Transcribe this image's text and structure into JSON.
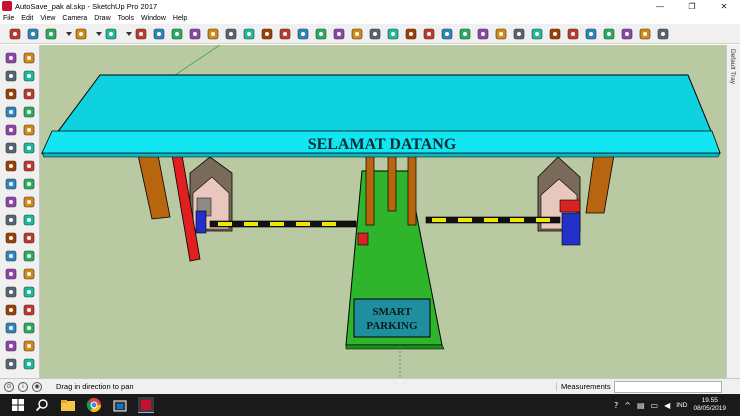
{
  "window": {
    "title": "AutoSave_pak al.skp - SketchUp Pro 2017",
    "minimize": "—",
    "maximize": "❐",
    "close": "✕"
  },
  "menu": [
    "File",
    "Edit",
    "View",
    "Camera",
    "Draw",
    "Tools",
    "Window",
    "Help"
  ],
  "toolbar_icons": [
    "select-icon",
    "eraser-icon",
    "pencil-icon",
    "dropdown-icon",
    "arc-icon",
    "dropdown-icon",
    "circle-icon",
    "dropdown-icon",
    "push-pull-icon",
    "follow-me-icon",
    "move-icon",
    "rotate-icon",
    "scale-icon",
    "tape-measure-icon",
    "text-icon",
    "paint-bucket-icon",
    "orbit-icon",
    "pan-icon",
    "zoom-icon",
    "zoom-extents-icon",
    "warehouse-icon",
    "extension-icon",
    "share-model-icon",
    "ruby-icon",
    "section-icon",
    "section-plane-icon",
    "xray-icon",
    "wireframe-icon",
    "hidden-line-icon",
    "shaded-icon",
    "textured-icon",
    "monochrome-icon",
    "iso-view-icon",
    "top-view-icon",
    "front-view-icon",
    "right-view-icon",
    "back-view-icon",
    "left-view-icon"
  ],
  "palette_icons": [
    "select-icon",
    "component-icon",
    "paint-bucket-icon",
    "eraser-icon",
    "line-icon",
    "freehand-icon",
    "rectangle-icon",
    "rotated-rectangle-icon",
    "circle-icon",
    "polygon-icon",
    "arc-icon",
    "pie-icon",
    "two-point-arc-icon",
    "three-point-arc-icon",
    "move-icon",
    "push-pull-icon",
    "rotate-icon",
    "follow-me-icon",
    "scale-icon",
    "offset-icon",
    "tape-measure-icon",
    "dimension-icon",
    "protractor-icon",
    "text-icon",
    "axes-icon",
    "3d-text-icon",
    "orbit-icon",
    "pan-icon",
    "zoom-icon",
    "zoom-window-icon",
    "zoom-extents-icon",
    "previous-view-icon",
    "position-camera-icon",
    "look-around-icon",
    "walk-icon",
    "section-plane-icon"
  ],
  "scene": {
    "sign_text": "SELAMAT DATANG",
    "panel_line1": "SMART",
    "panel_line2": "PARKING"
  },
  "colors": {
    "canvas": "#b9c9a1",
    "canopy_top": "#0fd2e0",
    "canopy_front": "#12e6f2",
    "pillar": "#b8650f",
    "island": "#2fb52c",
    "panel": "#1f8fa0",
    "barrier_yellow": "#f2e600",
    "barrier_black": "#111111"
  },
  "tray": {
    "label": "Default Tray"
  },
  "status": {
    "icons": [
      "geo-icon",
      "credit-icon",
      "user-icon"
    ],
    "hint": "Drag in direction to pan",
    "measurements_label": "Measurements",
    "measurements_value": ""
  },
  "taskbar": {
    "icons": [
      "windows-start-icon",
      "search-icon",
      "file-explorer-icon",
      "chrome-icon",
      "store-icon",
      "sketchup-icon"
    ],
    "tray_icons": [
      "help-icon",
      "chevron-up-icon",
      "network-icon",
      "battery-icon",
      "volume-icon"
    ],
    "language": "IND",
    "time": "19.55",
    "date": "08/05/2019"
  }
}
